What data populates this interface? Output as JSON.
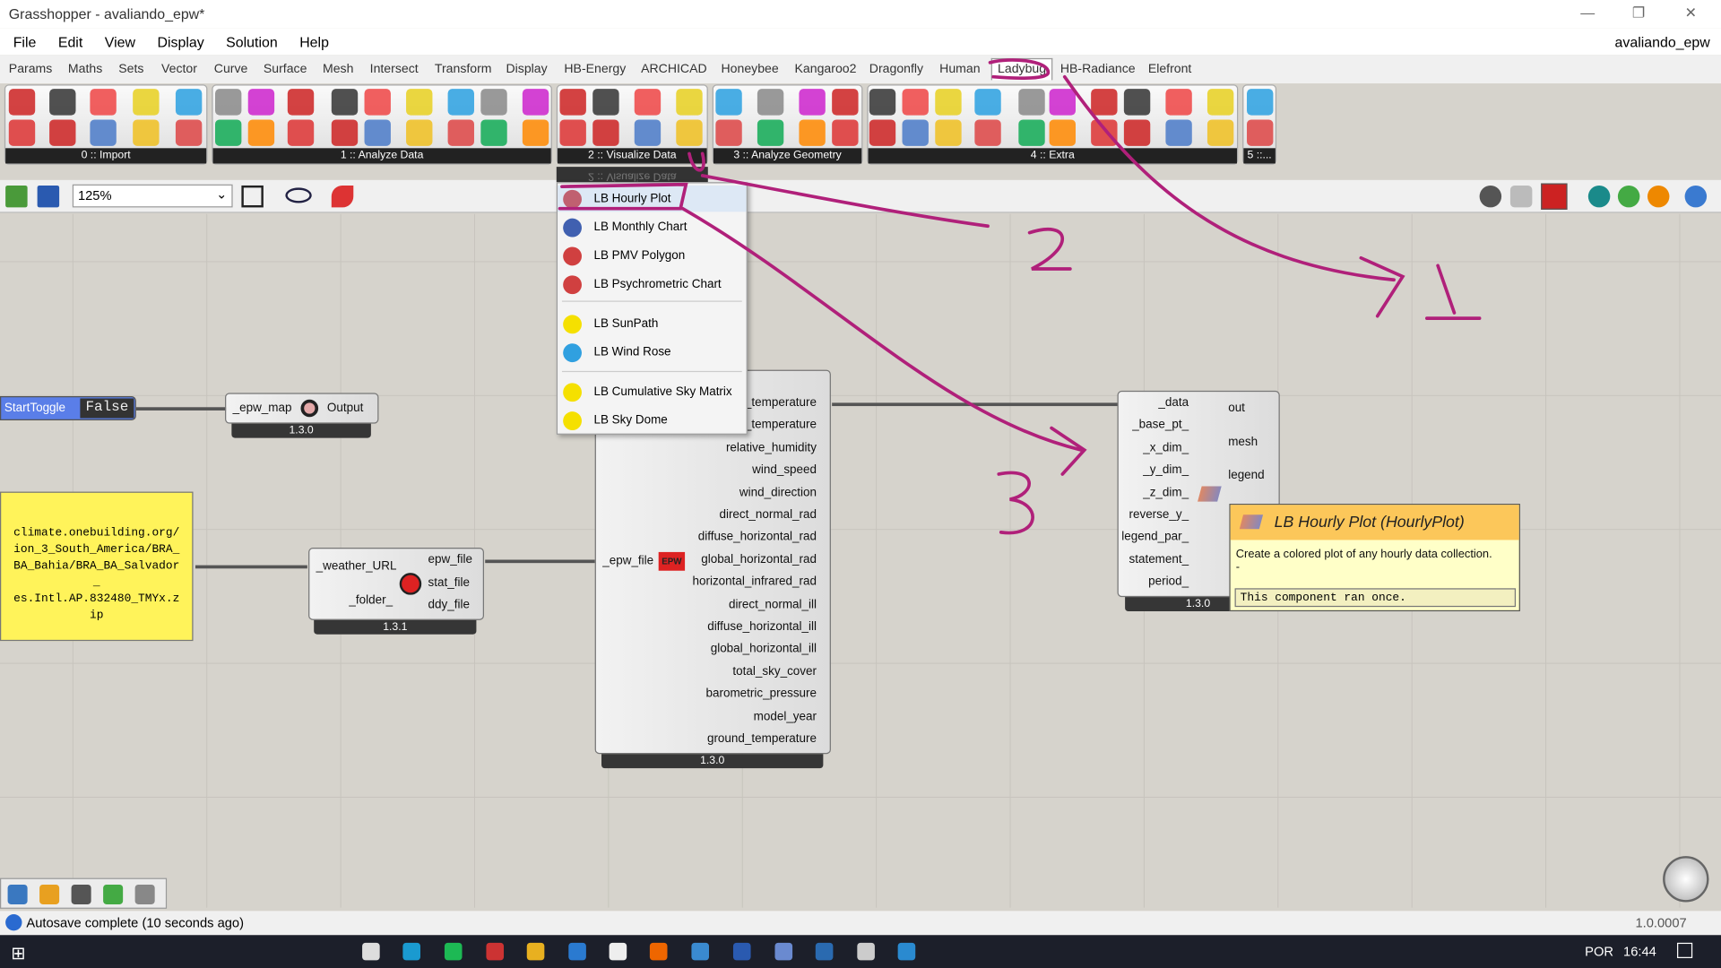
{
  "window": {
    "title": "Grasshopper - avaliando_epw*",
    "doc_name": "avaliando_epw",
    "minimize": "—",
    "restore": "❐",
    "close": "✕"
  },
  "menu": [
    "File",
    "Edit",
    "View",
    "Display",
    "Solution",
    "Help"
  ],
  "tabs": [
    "Params",
    "Maths",
    "Sets",
    "Vector",
    "Curve",
    "Surface",
    "Mesh",
    "Intersect",
    "Transform",
    "Display",
    "HB-Energy",
    "ARCHICAD",
    "Honeybee",
    "Kangaroo2",
    "Dragonfly",
    "Human",
    "Ladybug",
    "HB-Radiance",
    "Elefront"
  ],
  "active_tab": "Ladybug",
  "panels": [
    "0 :: Import",
    "1 :: Analyze Data",
    "2 :: Visualize Data",
    "3 :: Analyze Geometry",
    "4 :: Extra",
    "5 ::..."
  ],
  "toolbar": {
    "zoom": "125%"
  },
  "dropdown": {
    "header": "2 :: Visualize Data",
    "items": [
      {
        "label": "LB Hourly Plot",
        "icon": "hourly-plot-icon",
        "color": "#c06070"
      },
      {
        "label": "LB Monthly Chart",
        "icon": "monthly-chart-icon",
        "color": "#4060b0"
      },
      {
        "label": "LB PMV Polygon",
        "icon": "pmv-polygon-icon",
        "color": "#d04040"
      },
      {
        "label": "LB Psychrometric Chart",
        "icon": "psychrometric-chart-icon",
        "color": "#d04040"
      },
      {
        "label": "LB SunPath",
        "icon": "sunpath-icon",
        "color": "#f5e000"
      },
      {
        "label": "LB Wind Rose",
        "icon": "wind-rose-icon",
        "color": "#30a0e0"
      },
      {
        "label": "LB Cumulative Sky Matrix",
        "icon": "sky-matrix-icon",
        "color": "#f5e000"
      },
      {
        "label": "LB Sky Dome",
        "icon": "sky-dome-icon",
        "color": "#f5e000"
      }
    ]
  },
  "toggle": {
    "label": "StartToggle",
    "value": "False"
  },
  "epw_map": {
    "input": "_epw_map",
    "output": "Output",
    "version": "1.3.0"
  },
  "panel_note": {
    "lines": [
      "climate.onebuilding.org/",
      "ion_3_South_America/BRA_",
      "BA_Bahia/BRA_BA_Salvador",
      "_",
      "es.Intl.AP.832480_TMYx.z",
      "ip"
    ]
  },
  "download": {
    "inputs": [
      "_weather_URL",
      "_folder_"
    ],
    "outputs": [
      "epw_file",
      "stat_file",
      "ddy_file"
    ],
    "version": "1.3.1"
  },
  "import_epw": {
    "input": "_epw_file",
    "outputs": [
      "dry_bulb_temperature",
      "dew_point_temperature",
      "relative_humidity",
      "wind_speed",
      "wind_direction",
      "direct_normal_rad",
      "diffuse_horizontal_rad",
      "global_horizontal_rad",
      "horizontal_infrared_rad",
      "direct_normal_ill",
      "diffuse_horizontal_ill",
      "global_horizontal_ill",
      "total_sky_cover",
      "barometric_pressure",
      "model_year",
      "ground_temperature"
    ],
    "version": "1.3.0"
  },
  "hourly_plot": {
    "inputs": [
      "_data",
      "_base_pt_",
      "_x_dim_",
      "_y_dim_",
      "_z_dim_",
      "reverse_y_",
      "legend_par_",
      "statement_",
      "period_"
    ],
    "outputs": [
      "out",
      "mesh",
      "legend"
    ],
    "version": "1.3.0"
  },
  "tooltip": {
    "title": "LB Hourly Plot (HourlyPlot)",
    "description": "Create a colored plot of any hourly data collection.",
    "dash": "-",
    "status": "This component ran once."
  },
  "annotations": [
    "1",
    "2",
    "3"
  ],
  "annotation_color": "#b0207a",
  "status": {
    "message": "Autosave complete (10 seconds ago)",
    "version": "1.0.0007"
  },
  "taskbar": {
    "lang": "POR",
    "time": "16:44"
  }
}
